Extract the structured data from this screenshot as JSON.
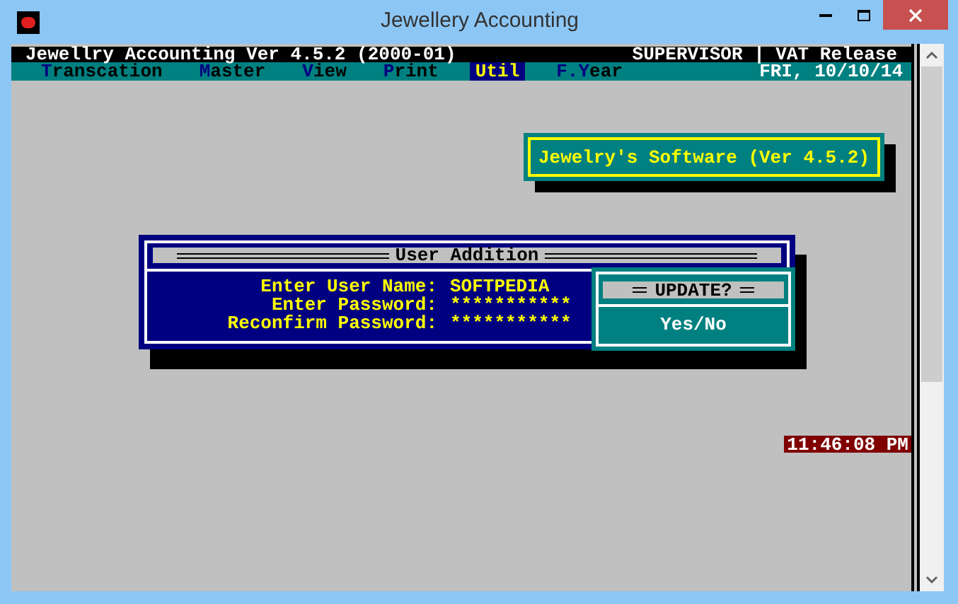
{
  "window": {
    "title": "Jewellery Accounting"
  },
  "header": {
    "app": "Jewellry Accounting Ver 4.5.2 (2000-01)",
    "user": "SUPERVISOR | VAT Release"
  },
  "menu": [
    {
      "hotkey": "T",
      "rest": "ranscation",
      "selected": false
    },
    {
      "hotkey": "M",
      "rest": "aster",
      "selected": false
    },
    {
      "hotkey": "V",
      "rest": "iew",
      "selected": false
    },
    {
      "hotkey": "P",
      "rest": "rint",
      "selected": false
    },
    {
      "hotkey": "U",
      "rest": "til",
      "selected": true
    },
    {
      "hotkey": "F.Y",
      "rest": "ear",
      "selected": false
    }
  ],
  "date": "FRI, 10/10/14",
  "banner": "Jewelry's Software (Ver 4.5.2)",
  "dialog": {
    "title": "User Addition",
    "fields": [
      {
        "label": "Enter User Name:",
        "value": "SOFTPEDIA"
      },
      {
        "label": "Enter Password:",
        "value": "***********"
      },
      {
        "label": "Reconfirm Password:",
        "value": "***********"
      }
    ]
  },
  "confirm": {
    "title": "UPDATE?",
    "prompt": "Yes/No"
  },
  "clock": "11:46:08 PM"
}
